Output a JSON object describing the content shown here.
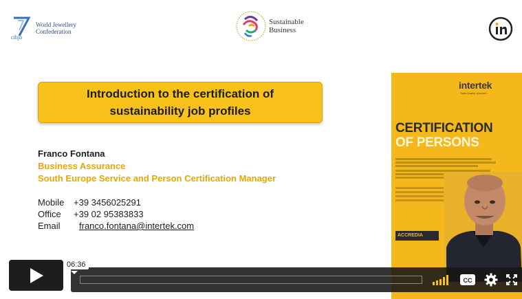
{
  "logos": {
    "cibjo": {
      "mark_text": "cibjo",
      "line1": "World Jewellery",
      "line2": "Confederation"
    },
    "sustainable_business": {
      "line1": "Sustainable",
      "line2": "Business"
    },
    "in_logo": "in"
  },
  "slide": {
    "title_line1": "Introduction to the certification of",
    "title_line2": "sustainability job profiles",
    "presenter_name": "Franco Fontana",
    "presenter_dept": "Business Assurance",
    "presenter_role": "South Europe Service and Person Certification Manager",
    "contacts": [
      {
        "label": "Mobile",
        "value": "+39 3456025291"
      },
      {
        "label": "Office",
        "value": "+39 02 95383833"
      },
      {
        "label": "Email",
        "value": "franco.fontana@intertek.com"
      }
    ]
  },
  "banner": {
    "logo": "intertek",
    "tagline": "Total Quality. Assured.",
    "heading1": "CERTIFICATION",
    "heading2": "OF PERSONS",
    "accredia": "ACCREDIA"
  },
  "player": {
    "timecode": "06:36",
    "icons": [
      "play-icon",
      "volume-icon",
      "closed-captions-icon",
      "settings-icon",
      "fullscreen-icon"
    ],
    "accent": "#f8c21a"
  }
}
